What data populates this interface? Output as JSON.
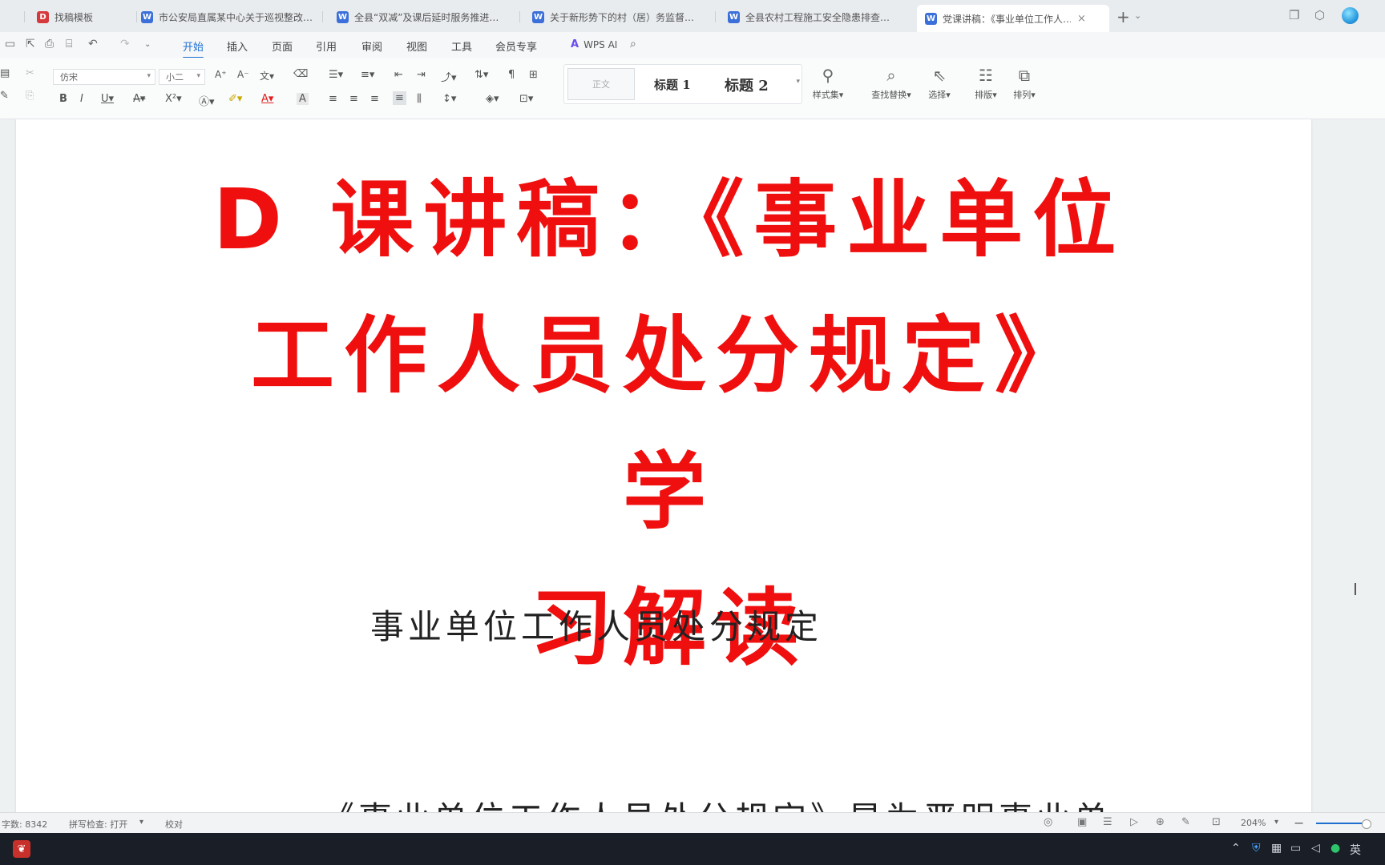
{
  "tabs": [
    {
      "label": "找稿模板",
      "icon": "D",
      "color": "#d6393b"
    },
    {
      "label": "市公安局直属某中心关于巡视整改…",
      "icon": "W",
      "color": "#3b6fd9"
    },
    {
      "label": "全县“双减”及课后延时服务推进…",
      "icon": "W",
      "color": "#3b6fd9"
    },
    {
      "label": "关于新形势下的村（居）务监督…",
      "icon": "W",
      "color": "#3b6fd9"
    },
    {
      "label": "全县农村工程施工安全隐患排查…",
      "icon": "W",
      "color": "#3b6fd9"
    },
    {
      "label": "党课讲稿：《事业单位工作人…",
      "icon": "W",
      "color": "#3b6fd9",
      "active": true
    }
  ],
  "menu": {
    "items": [
      "开始",
      "插入",
      "页面",
      "引用",
      "审阅",
      "视图",
      "工具",
      "会员专享"
    ],
    "ai_label": "WPS AI"
  },
  "ribbon": {
    "font_name": "仿宋",
    "font_size": "小二",
    "style_normal": "正文",
    "style_h1": "标题 1",
    "style_h2": "标题 2",
    "style_set": "样式集",
    "find_replace": "查找替换",
    "select": "选择",
    "layout": "排版",
    "arrange": "排列"
  },
  "document": {
    "title_line1": "D 课讲稿：《事业单位",
    "title_line2": "工作人员处分规定》学",
    "title_line3": "习解读",
    "subheading": "事业单位工作人员处分规定",
    "body_partial": "《事业单位工作人员处分规定》是为严明事业单"
  },
  "status": {
    "word_count": "字数: 8342",
    "spell_check": "拼写检查: 打开",
    "proof": "校对",
    "zoom": "204%"
  },
  "taskbar": {
    "ime": "英"
  }
}
